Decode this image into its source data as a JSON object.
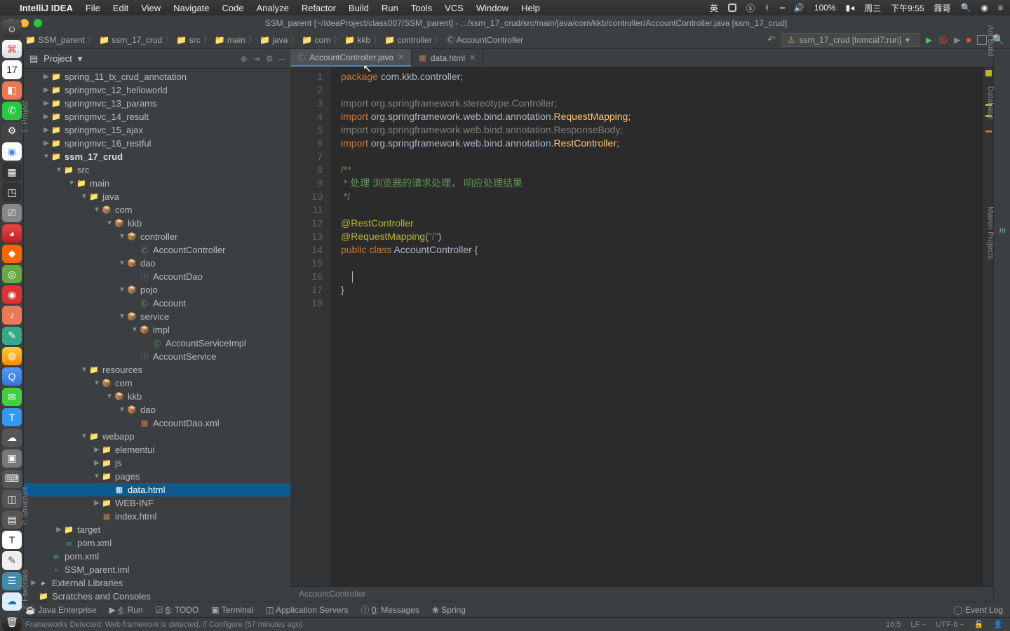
{
  "mac": {
    "app": "IntelliJ IDEA",
    "menus": [
      "File",
      "Edit",
      "View",
      "Navigate",
      "Code",
      "Analyze",
      "Refactor",
      "Build",
      "Run",
      "Tools",
      "VCS",
      "Window",
      "Help"
    ],
    "right": {
      "battery": "100%",
      "day": "周三",
      "time": "下午9:55",
      "user": "霖哥"
    }
  },
  "window": {
    "title": "SSM_parent [~/IdeaProject/class007/SSM_parent] - .../ssm_17_crud/src/main/java/com/kkb/controller/AccountController.java [ssm_17_crud]"
  },
  "breadcrumb": [
    "SSM_parent",
    "ssm_17_crud",
    "src",
    "main",
    "java",
    "com",
    "kkb",
    "controller",
    "AccountController"
  ],
  "runconfig": "ssm_17_crud [tomcat7:run]",
  "project": {
    "title": "Project"
  },
  "tree": [
    {
      "d": 1,
      "a": "r",
      "i": "folder",
      "n": "spring_11_tx_crud_annotation"
    },
    {
      "d": 1,
      "a": "r",
      "i": "folder",
      "n": "springmvc_12_helloworld"
    },
    {
      "d": 1,
      "a": "r",
      "i": "folder",
      "n": "springmvc_13_params"
    },
    {
      "d": 1,
      "a": "r",
      "i": "folder",
      "n": "springmvc_14_result"
    },
    {
      "d": 1,
      "a": "r",
      "i": "folder",
      "n": "springmvc_15_ajax"
    },
    {
      "d": 1,
      "a": "r",
      "i": "folder",
      "n": "springmvc_16_restful"
    },
    {
      "d": 1,
      "a": "d",
      "i": "folder",
      "n": "ssm_17_crud",
      "b": true
    },
    {
      "d": 2,
      "a": "d",
      "i": "src",
      "n": "src"
    },
    {
      "d": 3,
      "a": "d",
      "i": "src",
      "n": "main"
    },
    {
      "d": 4,
      "a": "d",
      "i": "src",
      "n": "java"
    },
    {
      "d": 5,
      "a": "d",
      "i": "pkg",
      "n": "com"
    },
    {
      "d": 6,
      "a": "d",
      "i": "pkg",
      "n": "kkb"
    },
    {
      "d": 7,
      "a": "d",
      "i": "pkg",
      "n": "controller"
    },
    {
      "d": 8,
      "a": "",
      "i": "jclass",
      "n": "AccountController"
    },
    {
      "d": 7,
      "a": "d",
      "i": "pkg",
      "n": "dao"
    },
    {
      "d": 8,
      "a": "",
      "i": "jint",
      "n": "AccountDao"
    },
    {
      "d": 7,
      "a": "d",
      "i": "pkg",
      "n": "pojo"
    },
    {
      "d": 8,
      "a": "",
      "i": "jclass",
      "n": "Account"
    },
    {
      "d": 7,
      "a": "d",
      "i": "pkg",
      "n": "service"
    },
    {
      "d": 8,
      "a": "d",
      "i": "pkg",
      "n": "impl"
    },
    {
      "d": 9,
      "a": "",
      "i": "jclass",
      "n": "AccountServiceImpl"
    },
    {
      "d": 8,
      "a": "",
      "i": "jint",
      "n": "AccountService"
    },
    {
      "d": 4,
      "a": "d",
      "i": "folder",
      "n": "resources"
    },
    {
      "d": 5,
      "a": "d",
      "i": "pkg",
      "n": "com"
    },
    {
      "d": 6,
      "a": "d",
      "i": "pkg",
      "n": "kkb"
    },
    {
      "d": 7,
      "a": "d",
      "i": "pkg",
      "n": "dao"
    },
    {
      "d": 8,
      "a": "",
      "i": "xml",
      "n": "AccountDao.xml"
    },
    {
      "d": 4,
      "a": "d",
      "i": "folder",
      "n": "webapp"
    },
    {
      "d": 5,
      "a": "r",
      "i": "folder",
      "n": "elementui"
    },
    {
      "d": 5,
      "a": "r",
      "i": "folder",
      "n": "js"
    },
    {
      "d": 5,
      "a": "d",
      "i": "folder",
      "n": "pages"
    },
    {
      "d": 6,
      "a": "",
      "i": "html",
      "n": "data.html",
      "sel": true
    },
    {
      "d": 5,
      "a": "r",
      "i": "folder",
      "n": "WEB-INF"
    },
    {
      "d": 5,
      "a": "",
      "i": "html",
      "n": "index.html"
    },
    {
      "d": 2,
      "a": "r",
      "i": "folder",
      "n": "target"
    },
    {
      "d": 2,
      "a": "",
      "i": "m",
      "n": "pom.xml"
    },
    {
      "d": 1,
      "a": "",
      "i": "m",
      "n": "pom.xml"
    },
    {
      "d": 1,
      "a": "",
      "i": "file",
      "n": "SSM_parent.iml"
    },
    {
      "d": 0,
      "a": "r",
      "i": "lib",
      "n": "External Libraries"
    },
    {
      "d": 0,
      "a": "",
      "i": "folder",
      "n": "Scratches and Consoles"
    }
  ],
  "tabs": [
    {
      "label": "AccountController.java",
      "active": true,
      "icon": "C"
    },
    {
      "label": "data.html",
      "active": false,
      "icon": "H"
    }
  ],
  "code": {
    "lines": 18,
    "l1_kw": "package",
    "l1_rest": " com.kkb.controller;",
    "l3": "import org.springframework.stereotype.Controller;",
    "l4_kw": "import",
    "l4_mid": " org.springframework.web.bind.annotation.",
    "l4_cls": "RequestMapping",
    "l4_end": ";",
    "l5": "import org.springframework.web.bind.annotation.ResponseBody;",
    "l6_kw": "import",
    "l6_mid": " org.springframework.web.bind.annotation.",
    "l6_cls": "RestController",
    "l6_end": ";",
    "l8": "/**",
    "l9": " * 处理 浏览器的请求处理， 响应处理结果",
    "l10": " */",
    "l12": "@RestController",
    "l13a": "@RequestMapping",
    "l13b": "(",
    "l13c": "\"/\"",
    "l13d": ")",
    "l14a": "public ",
    "l14b": "class ",
    "l14c": "AccountController ",
    "l14d": "{",
    "l17": "}"
  },
  "crumb2": "AccountController",
  "bottom": {
    "items": [
      "Java Enterprise",
      "4: Run",
      "6: TODO",
      "Terminal",
      "Application Servers",
      "0: Messages",
      "Spring"
    ],
    "event": "Event Log"
  },
  "status": {
    "msg": "Frameworks Detected: Web framework is detected. // Configure (57 minutes ago)",
    "pos": "16:5",
    "le": "LF",
    "enc": "UTF-8"
  },
  "rightStrip": [
    "Ant Build",
    "Database",
    "Maven Projects"
  ],
  "leftStrip": [
    "1: Project",
    "7: Structure",
    "2: Favorites"
  ]
}
